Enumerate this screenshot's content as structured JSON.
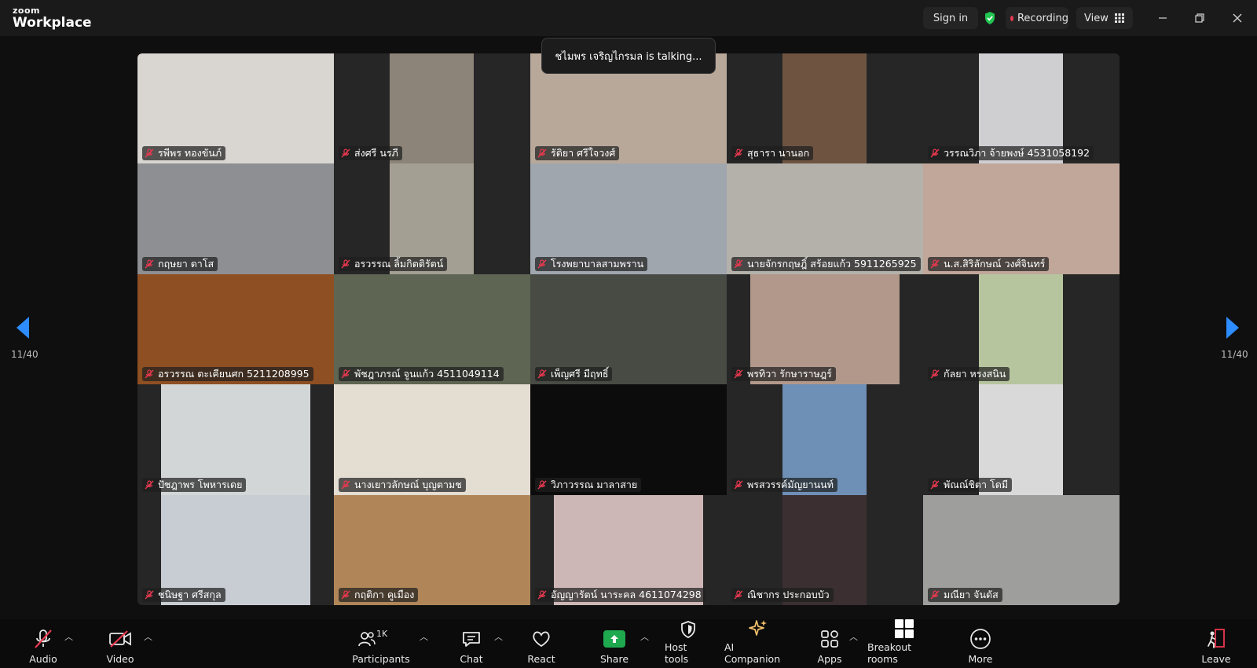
{
  "app": {
    "brand_top": "zoom",
    "brand_bottom": "Workplace"
  },
  "titlebar": {
    "sign_in": "Sign in",
    "recording": "Recording",
    "view": "View"
  },
  "speaker_banner": "ชไมพร เจริญไกรมล is talking...",
  "pagination": {
    "left": "11/40",
    "right": "11/40"
  },
  "participants": [
    {
      "name": "รพีพร ทองขันภ์",
      "bg": "#d9d6d2",
      "frame": "full"
    },
    {
      "name": "ส่งศรี นรภี",
      "bg": "#8c8478",
      "frame": "narrow"
    },
    {
      "name": "รัติยา ศรีใจวงศ์",
      "bg": "#b8a89a",
      "frame": "full"
    },
    {
      "name": "สุธารา นานอก",
      "bg": "#6e5440",
      "frame": "narrow"
    },
    {
      "name": "วรรณวิภา จ้ายพงษ์ 4531058192",
      "bg": "#cfcfd2",
      "frame": "narrow"
    },
    {
      "name": "กฤษยา ดาโส",
      "bg": "#8d8f92",
      "frame": "full"
    },
    {
      "name": "อรวรรณ ลิ้มกิตติรัตน์",
      "bg": "#a49f93",
      "frame": "narrow"
    },
    {
      "name": "โรงพยาบาลสามพราน",
      "bg": "#9fa6ae",
      "frame": "full"
    },
    {
      "name": "นายจักรกฤษฎิ์ สร้อยแก้ว 5911265925",
      "bg": "#b4b1ab",
      "frame": "full"
    },
    {
      "name": "น.ส.สิริลักษณ์ วงศ์จินทร์",
      "bg": "#c1a69a",
      "frame": "full"
    },
    {
      "name": "อรวรรณ ตะเคียนศก 5211208995",
      "bg": "#8e4f22",
      "frame": "full"
    },
    {
      "name": "พัชฎาภรณ์ จูนแก้ว 4511049114",
      "bg": "#5e6552",
      "frame": "full"
    },
    {
      "name": "เพ็ญศรี มีฤทธิ์",
      "bg": "#474b43",
      "frame": "full"
    },
    {
      "name": "พรทิวา รักษาราษฎร์",
      "bg": "#b2988a",
      "frame": "mid"
    },
    {
      "name": "กัลยา หรงสนิน",
      "bg": "#b7c59f",
      "frame": "narrow"
    },
    {
      "name": "ปัชฎาพร โพหารเดย",
      "bg": "#d2d6d6",
      "frame": "mid"
    },
    {
      "name": "นางเยาวลักษณ์ บุญตามช",
      "bg": "#e3ddd2",
      "frame": "full"
    },
    {
      "name": "วิภาวรรณ มาลาสาย",
      "bg": "#0c0c0c",
      "frame": "full"
    },
    {
      "name": "พรสวรรค์มัญยานนท์",
      "bg": "#6e8fb6",
      "frame": "narrow"
    },
    {
      "name": "พัณณ์ชิตา โดมี",
      "bg": "#d9d9d9",
      "frame": "narrow"
    },
    {
      "name": "ชนิษฐา ศรีสกุล",
      "bg": "#c8ccd3",
      "frame": "mid"
    },
    {
      "name": "กฤติกา คูเมือง",
      "bg": "#b08658",
      "frame": "full"
    },
    {
      "name": "อัญญารัตน์ นาระคล 4611074298",
      "bg": "#cdb7b6",
      "frame": "mid"
    },
    {
      "name": "ณิชากร ประกอบบัว",
      "bg": "#3b2f31",
      "frame": "narrow"
    },
    {
      "name": "มณียา จันดัส",
      "bg": "#9e9e9c",
      "frame": "full"
    }
  ],
  "toolbar": {
    "audio": "Audio",
    "video": "Video",
    "participants": "Participants",
    "participants_count": "1K",
    "chat": "Chat",
    "react": "React",
    "share": "Share",
    "host_tools": "Host tools",
    "ai_companion": "AI Companion",
    "apps": "Apps",
    "breakout_rooms": "Breakout rooms",
    "more": "More",
    "leave": "Leave"
  },
  "colors": {
    "accent_blue": "#2d8cff",
    "share_green": "#1ea94f",
    "muted_red": "#e8384f",
    "ai_gold": "#f5c26b"
  }
}
